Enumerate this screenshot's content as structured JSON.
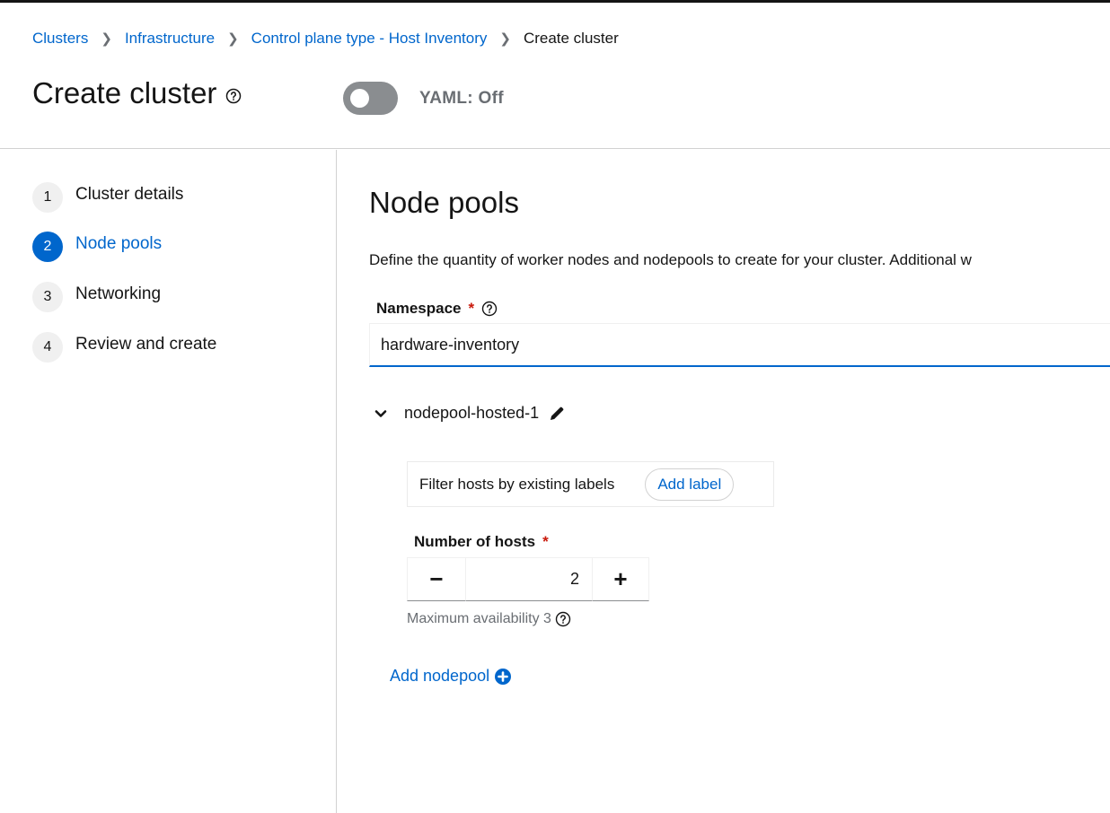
{
  "breadcrumb": {
    "items": [
      "Clusters",
      "Infrastructure",
      "Control plane type - Host Inventory"
    ],
    "current": "Create cluster"
  },
  "page": {
    "title": "Create cluster",
    "yaml_label": "YAML: Off"
  },
  "wizard": {
    "steps": [
      {
        "num": "1",
        "label": "Cluster details"
      },
      {
        "num": "2",
        "label": "Node pools"
      },
      {
        "num": "3",
        "label": "Networking"
      },
      {
        "num": "4",
        "label": "Review and create"
      }
    ]
  },
  "main": {
    "title": "Node pools",
    "description": "Define the quantity of worker nodes and nodepools to create for your cluster. Additional w",
    "namespace": {
      "label": "Namespace",
      "required_mark": "*",
      "value": "hardware-inventory"
    },
    "nodepool": {
      "name": "nodepool-hosted-1",
      "filter_text": "Filter hosts by existing labels",
      "add_label": "Add label",
      "hosts_label": "Number of hosts",
      "required_mark": "*",
      "minus": "−",
      "value": "2",
      "plus": "+",
      "max_availability": "Maximum availability 3"
    },
    "add_nodepool": "Add nodepool"
  },
  "colors": {
    "link": "#0066cc",
    "required": "#c9190b",
    "toggle_off": "#8a8d90"
  }
}
